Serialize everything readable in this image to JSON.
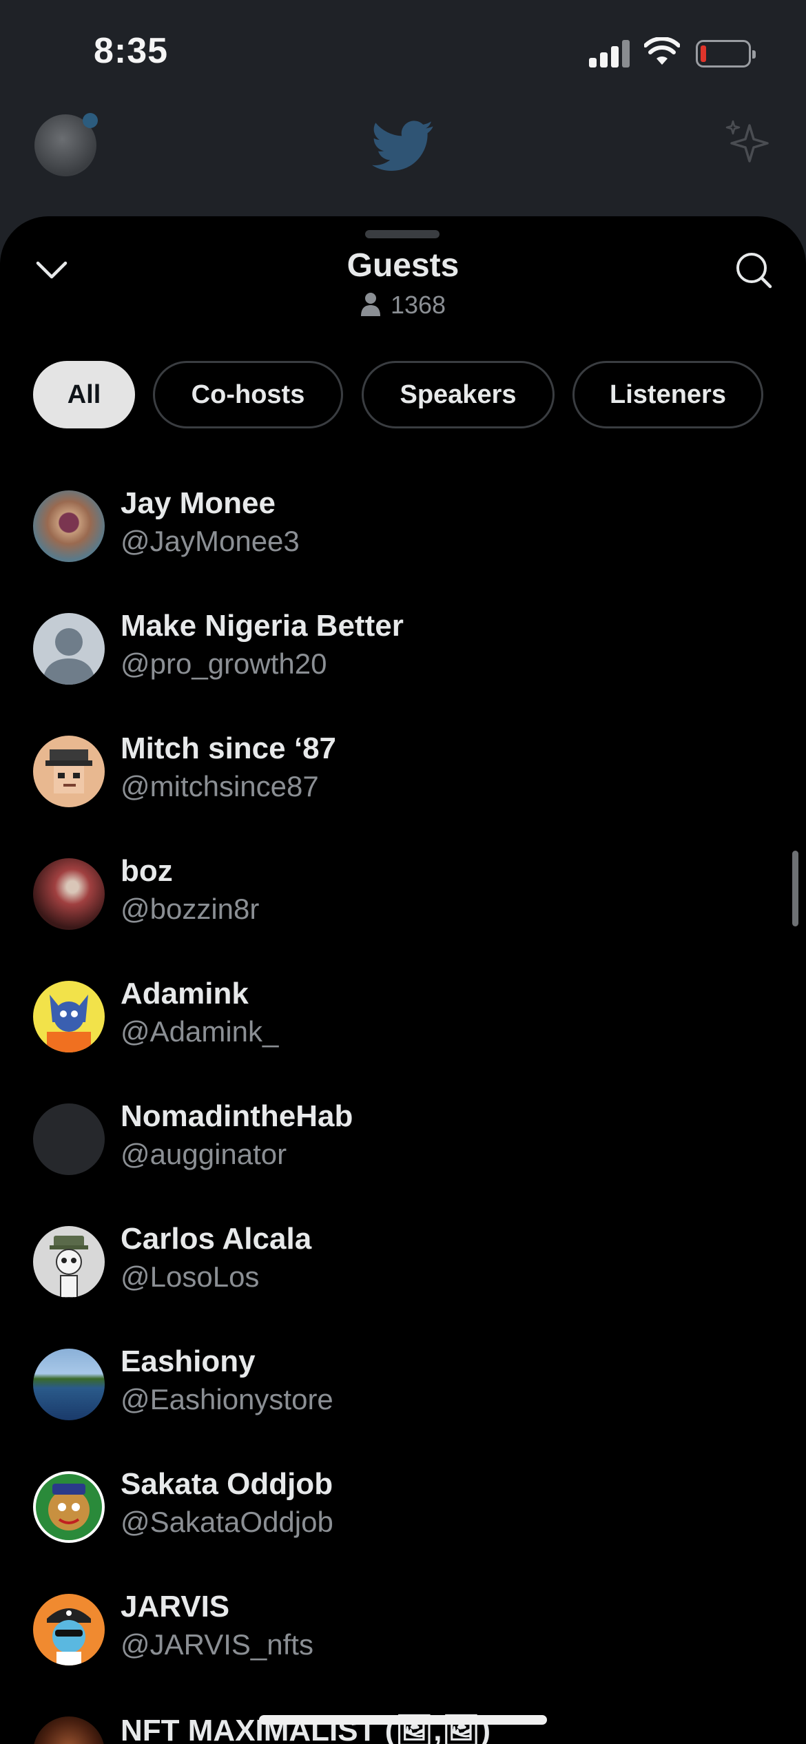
{
  "status_bar": {
    "time": "8:35",
    "signal_bars_active": 3,
    "battery_level": "low"
  },
  "background_app": {
    "logo": "twitter-bird-icon",
    "right_icon": "sparkle-icon"
  },
  "sheet": {
    "title": "Guests",
    "count": "1368",
    "tabs": [
      {
        "label": "All",
        "active": true
      },
      {
        "label": "Co-hosts",
        "active": false
      },
      {
        "label": "Speakers",
        "active": false
      },
      {
        "label": "Listeners",
        "active": false
      }
    ],
    "guests": [
      {
        "name": "Jay Monee",
        "handle": "@JayMonee3"
      },
      {
        "name": "Make Nigeria Better",
        "handle": "@pro_growth20"
      },
      {
        "name": "Mitch since ‘87",
        "handle": "@mitchsince87"
      },
      {
        "name": "boz",
        "handle": "@bozzin8r"
      },
      {
        "name": "Adamink",
        "handle": "@Adamink_"
      },
      {
        "name": "NomadintheHab",
        "handle": "@augginator"
      },
      {
        "name": "Carlos Alcala",
        "handle": "@LosoLos"
      },
      {
        "name": "Eashiony",
        "handle": "@Eashionystore"
      },
      {
        "name": "Sakata Oddjob",
        "handle": "@SakataOddjob"
      },
      {
        "name": "JARVIS",
        "handle": "@JARVIS_nfts"
      },
      {
        "name": "NFT MAXIMALIST (🖼,🖼)",
        "handle": ""
      }
    ]
  },
  "colors": {
    "background": "#000000",
    "active_tab": "#e4e4e4",
    "secondary_text": "#8b8f94",
    "primary_text": "#e7e9ea"
  }
}
